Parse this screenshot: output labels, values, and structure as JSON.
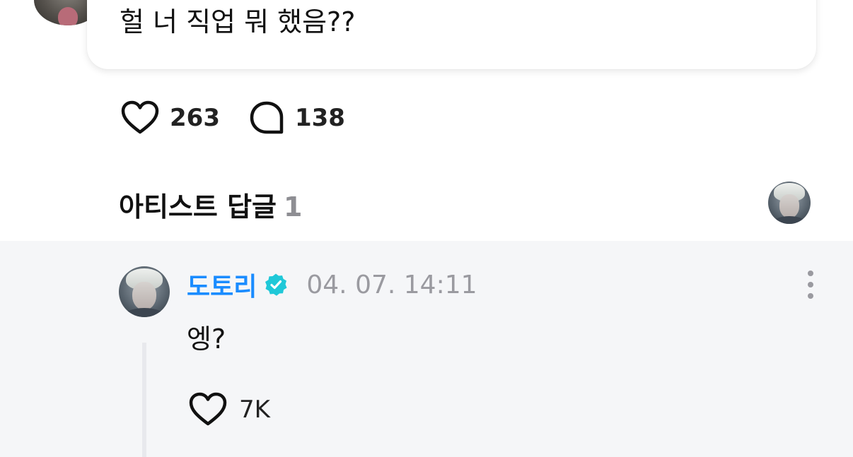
{
  "post": {
    "text": "헐 너 직업 뭐 했음??",
    "like_count": "263",
    "comment_count": "138"
  },
  "artist_replies": {
    "title": "아티스트 답글",
    "count": "1"
  },
  "reply": {
    "author": "도토리",
    "timestamp": "04. 07. 14:11",
    "text": "엥?",
    "like_count": "7K"
  },
  "icons": {
    "like": "heart-icon",
    "comment": "comment-bubble-icon",
    "verified": "verified-badge-icon",
    "more": "more-vertical-icon"
  },
  "colors": {
    "author_name": "#1a8cff",
    "verified_badge": "#1fc8d8",
    "reply_background": "#f5f6f8",
    "muted_text": "#9a9aa0"
  }
}
